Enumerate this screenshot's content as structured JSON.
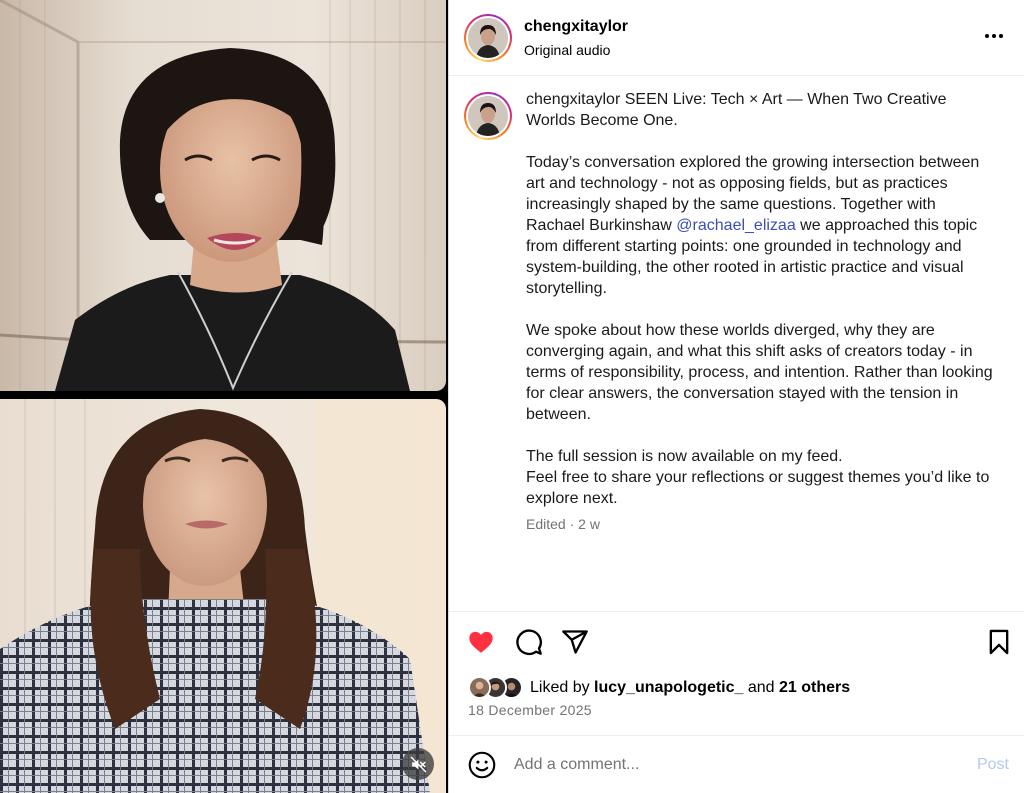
{
  "header": {
    "username": "chengxitaylor",
    "subtitle": "Original audio",
    "more_icon": "more-horizontal-icon"
  },
  "caption": {
    "username": "chengxitaylor",
    "title_line": "SEEN Live: Tech × Art — When Two Creative Worlds Become One.",
    "p1_before": "Today’s conversation explored the growing intersection between art and technology - not as opposing fields, but as practices increasingly shaped by the same questions. Together with Rachael Burkinshaw ",
    "mention": "@rachael_elizaa",
    "p1_after": " we approached this topic from different starting points: one grounded in technology and system-building, the other rooted in artistic practice and visual storytelling.",
    "p2": "We spoke about how these worlds diverged, why they are converging again, and what this shift asks of creators today - in terms of responsibility, process, and intention. Rather than looking for clear answers, the conversation stayed with the tension in between.",
    "p3_line1": "The full session is now available on my feed.",
    "p3_line2": "Feel free to share your reflections or suggest themes you’d like to explore next.",
    "meta": "Edited · 2 w"
  },
  "actions": {
    "like_icon": "heart-filled-icon",
    "comment_icon": "comment-bubble-icon",
    "share_icon": "paper-plane-icon",
    "save_icon": "bookmark-icon",
    "liked": true,
    "like_color": "#ff3040"
  },
  "likes": {
    "prefix": "Liked by ",
    "first_user": "lucy_unapologetic_",
    "middle": " and ",
    "others": "21 others"
  },
  "date": "18 December 2025",
  "comment": {
    "placeholder": "Add a comment...",
    "post_label": "Post",
    "emoji_icon": "emoji-smiley-icon"
  },
  "media": {
    "mute_icon": "speaker-muted-icon",
    "muted": true
  },
  "colors": {
    "mention": "#3b4eb6",
    "secondary_text": "#737373",
    "post_button_disabled": "#b2c9f3"
  }
}
